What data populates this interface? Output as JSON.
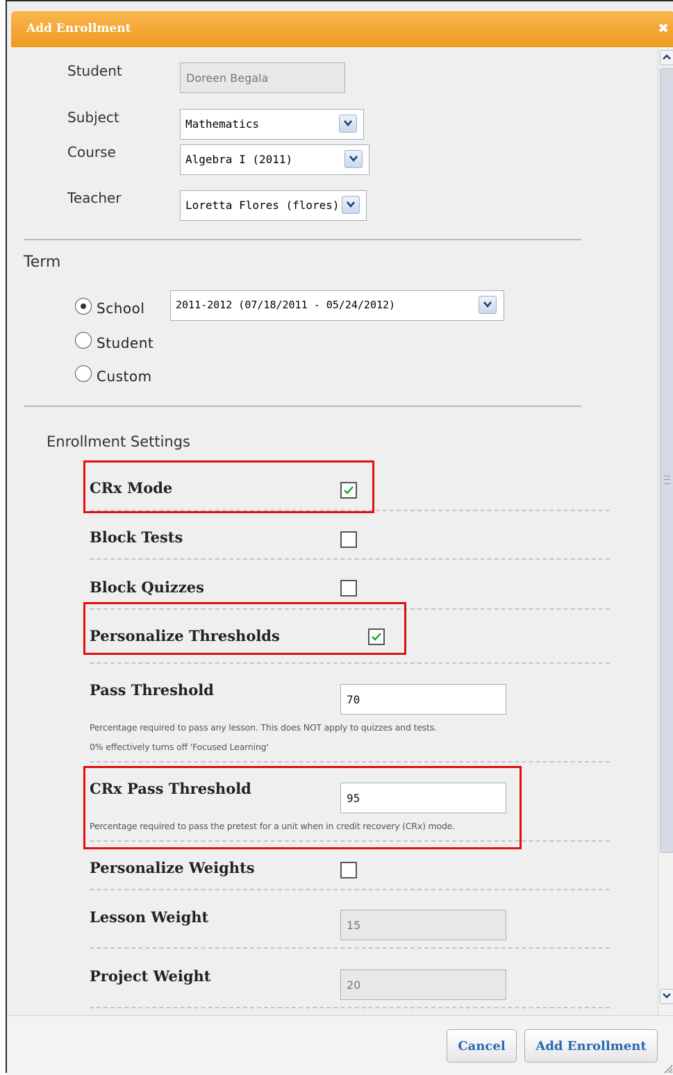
{
  "dialog": {
    "title": "Add Enrollment",
    "close_glyph": "✖"
  },
  "form": {
    "student_label": "Student",
    "student_value": "Doreen Begala",
    "subject_label": "Subject",
    "subject_value": "Mathematics",
    "course_label": "Course",
    "course_value": "Algebra I (2011)",
    "teacher_label": "Teacher",
    "teacher_value": "Loretta Flores (flores)"
  },
  "term": {
    "heading": "Term",
    "options": [
      {
        "label": "School",
        "selected": true
      },
      {
        "label": "Student",
        "selected": false
      },
      {
        "label": "Custom",
        "selected": false
      }
    ],
    "school_term_value": "2011-2012 (07/18/2011 - 05/24/2012)"
  },
  "settings": {
    "heading": "Enrollment Settings",
    "crx_mode": {
      "label": "CRx Mode",
      "checked": true
    },
    "block_tests": {
      "label": "Block Tests",
      "checked": false
    },
    "block_quizzes": {
      "label": "Block Quizzes",
      "checked": false
    },
    "personalize_thresholds": {
      "label": "Personalize Thresholds",
      "checked": true
    },
    "pass_threshold": {
      "label": "Pass Threshold",
      "value": "70",
      "hint_line1": "Percentage required to pass any lesson. This does NOT apply to quizzes and tests.",
      "hint_line2": "0% effectively turns off 'Focused Learning'"
    },
    "crx_pass_threshold": {
      "label": "CRx Pass Threshold",
      "value": "95",
      "hint": "Percentage required to pass the pretest for a unit when in credit recovery (CRx) mode."
    },
    "personalize_weights": {
      "label": "Personalize Weights",
      "checked": false
    },
    "lesson_weight": {
      "label": "Lesson Weight",
      "value": "15"
    },
    "project_weight": {
      "label": "Project Weight",
      "value": "20"
    }
  },
  "footer": {
    "cancel_label": "Cancel",
    "add_label": "Add Enrollment"
  },
  "colors": {
    "title_bar": "#f5a834",
    "button_text": "#2a68b0",
    "highlight_box": "#e01010",
    "check": "#1aa61a"
  }
}
